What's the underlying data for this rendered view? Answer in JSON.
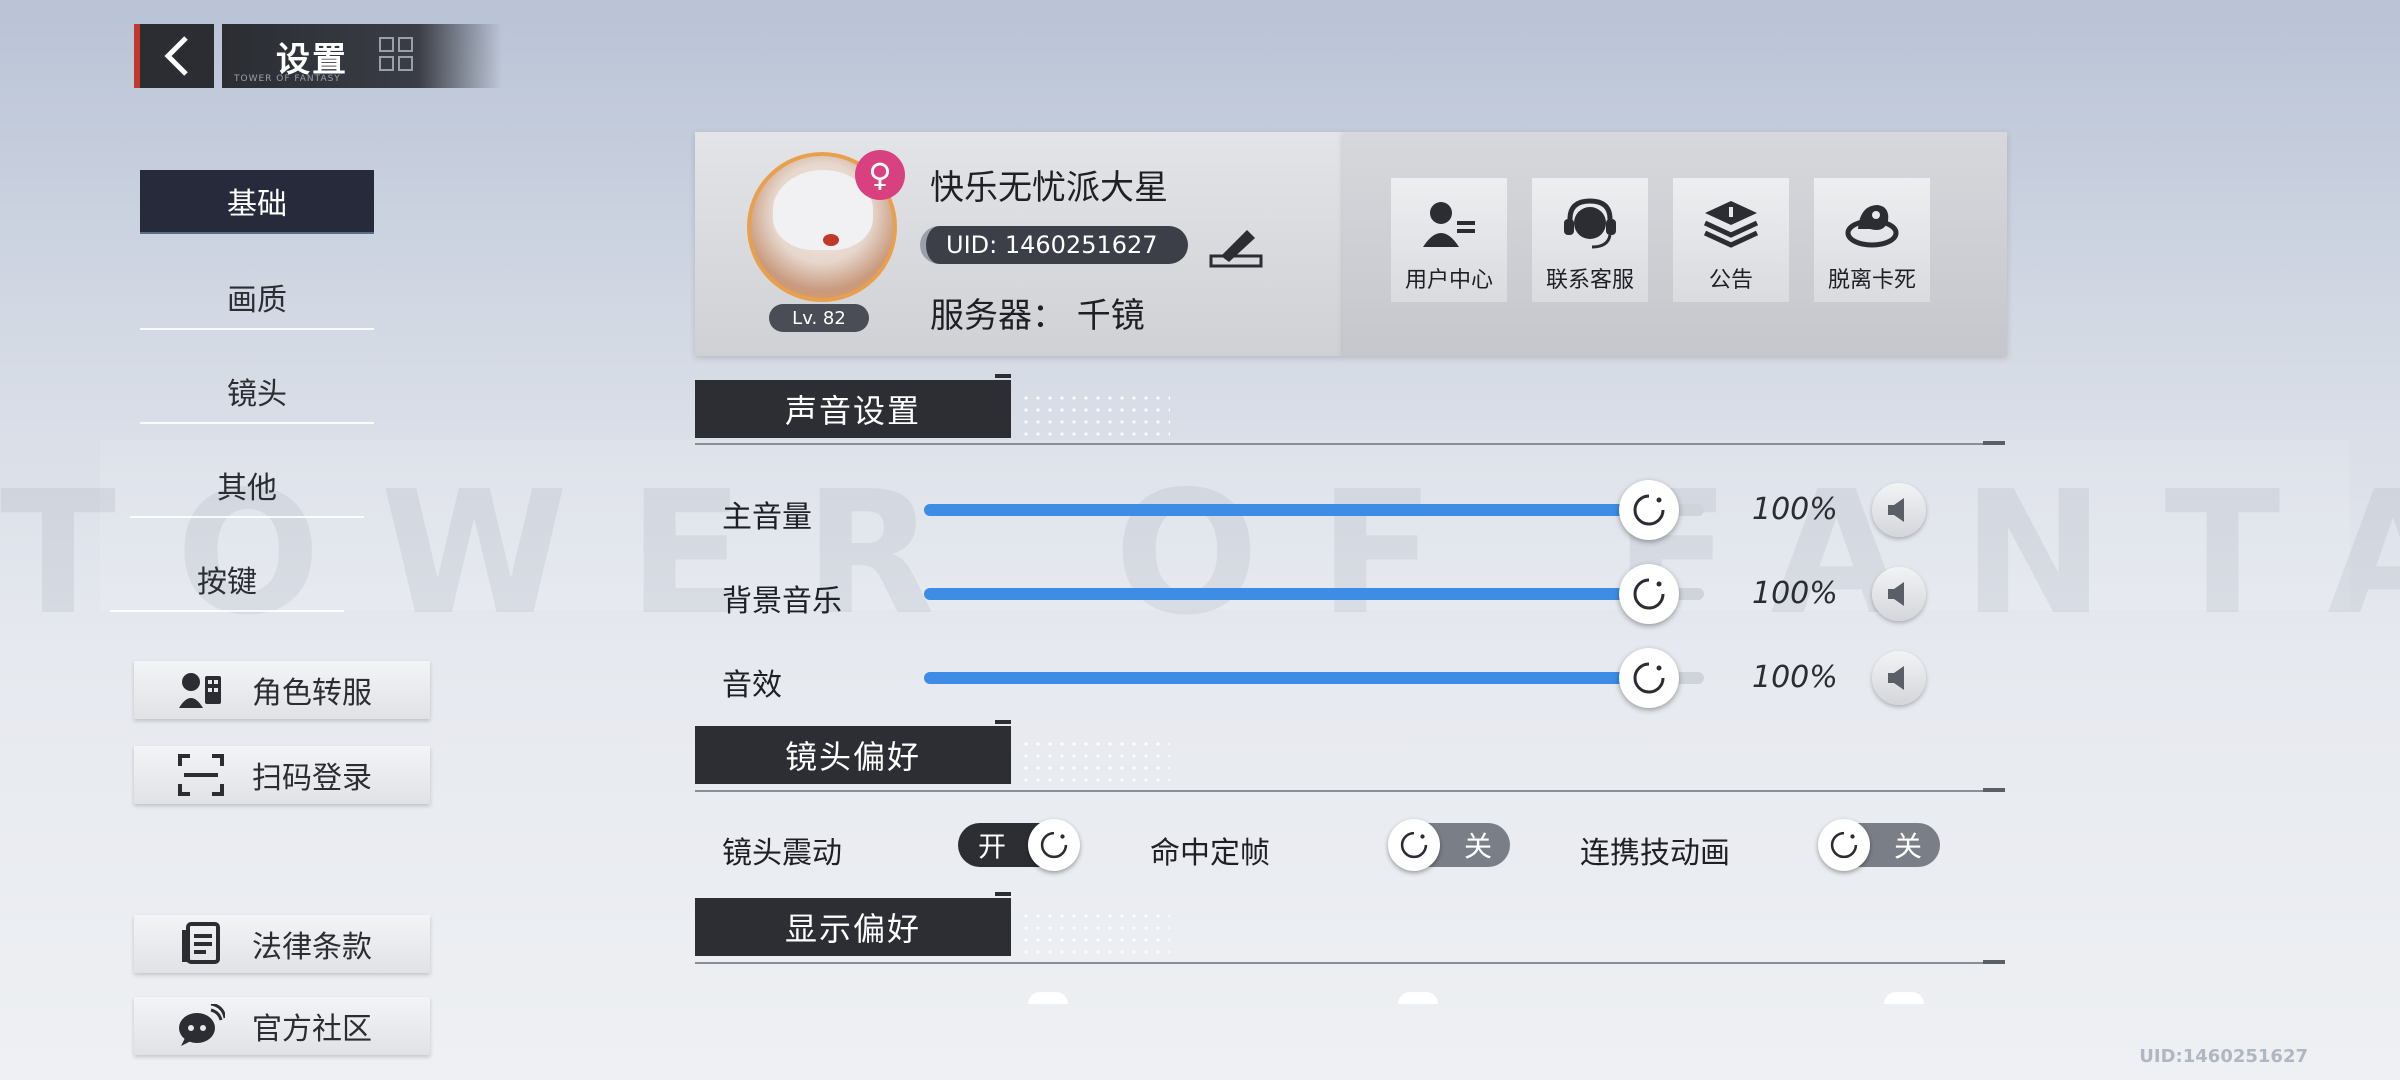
{
  "header": {
    "title": "设置",
    "subtitle": "TOWER OF FANTASY"
  },
  "background_watermark": "TOWER OF FANTASY",
  "nav": {
    "items": [
      {
        "label": "基础",
        "active": true
      },
      {
        "label": "画质",
        "active": false
      },
      {
        "label": "镜头",
        "active": false
      },
      {
        "label": "其他",
        "active": false
      },
      {
        "label": "按键",
        "active": false
      }
    ]
  },
  "side_buttons": {
    "transfer": {
      "label": "角色转服",
      "icon": "character-transfer-icon"
    },
    "qr_login": {
      "label": "扫码登录",
      "icon": "qr-scan-icon"
    },
    "legal": {
      "label": "法律条款",
      "icon": "document-icon"
    },
    "community": {
      "label": "官方社区",
      "icon": "chat-bubble-icon"
    }
  },
  "profile": {
    "name": "快乐无忧派大星",
    "uid": "UID: 1460251627",
    "server": "服务器： 千镜",
    "level": "Lv. 82",
    "gender_symbol": "♀",
    "gender_color": "#d84080"
  },
  "actions": [
    {
      "label": "用户中心",
      "icon": "user-center-icon"
    },
    {
      "label": "联系客服",
      "icon": "headset-icon"
    },
    {
      "label": "公告",
      "icon": "announcement-icon"
    },
    {
      "label": "脱离卡死",
      "icon": "unstuck-icon"
    }
  ],
  "sections": {
    "sound": "声音设置",
    "camera": "镜头偏好",
    "display": "显示偏好"
  },
  "volume": {
    "master": {
      "label": "主音量",
      "value": 100,
      "display": "100%"
    },
    "music": {
      "label": "背景音乐",
      "value": 100,
      "display": "100%"
    },
    "sfx": {
      "label": "音效",
      "value": 100,
      "display": "100%"
    }
  },
  "camera_toggles": {
    "shake": {
      "label": "镜头震动",
      "state": "开",
      "on": true
    },
    "hitstop": {
      "label": "命中定帧",
      "state": "关",
      "on": false
    },
    "combo_anim": {
      "label": "连携技动画",
      "state": "关",
      "on": false
    }
  },
  "footer_uid": "UID:1460251627",
  "colors": {
    "accent_blue": "#3d8ce6",
    "dark_panel": "#2c2e34",
    "back_accent": "#c0392b"
  }
}
